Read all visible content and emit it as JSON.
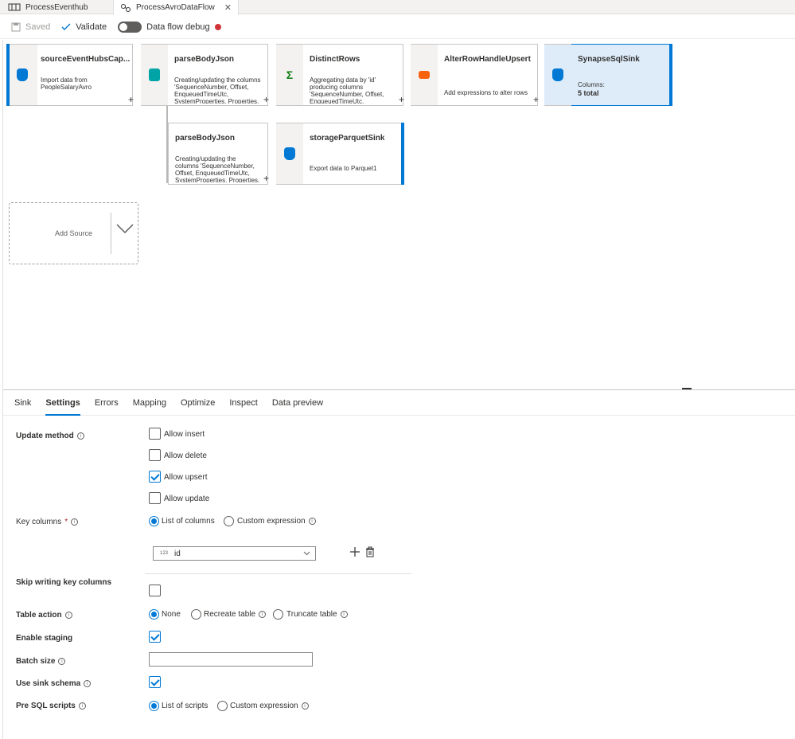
{
  "tabs": [
    {
      "label": "ProcessEventhub",
      "active": false
    },
    {
      "label": "ProcessAvroDataFlow",
      "active": true,
      "close": "✕"
    }
  ],
  "toolbar": {
    "saved": "Saved",
    "validate": "Validate",
    "debug": "Data flow debug"
  },
  "nodes": {
    "source": {
      "title": "sourceEventHubsCap...",
      "desc": "Import data from PeopleSalaryAvro"
    },
    "parse1": {
      "title": "parseBodyJson",
      "desc": "Creating/updating the columns 'SequenceNumber, Offset, EnqueuedTimeUtc, SystemProperties, Properties,"
    },
    "distinct": {
      "title": "DistinctRows",
      "desc": "Aggregating data by 'id' producing columns 'SequenceNumber, Offset, EnqueuedTimeUtc,"
    },
    "alter": {
      "title": "AlterRowHandleUpsert",
      "desc": "Add expressions to alter rows"
    },
    "sqlsink": {
      "title": "SynapseSqlSink",
      "cols_label": "Columns:",
      "cols_value": "5 total"
    },
    "parse2": {
      "title": "parseBodyJson",
      "desc": "Creating/updating the columns 'SequenceNumber, Offset, EnqueuedTimeUtc, SystemProperties, Properties,"
    },
    "parquet": {
      "title": "storageParquetSink",
      "desc": "Export data to Parquet1"
    }
  },
  "add_source": "Add Source",
  "panel_tabs": [
    "Sink",
    "Settings",
    "Errors",
    "Mapping",
    "Optimize",
    "Inspect",
    "Data preview"
  ],
  "settings": {
    "update_method": "Update method",
    "allow_insert": "Allow insert",
    "allow_delete": "Allow delete",
    "allow_upsert": "Allow upsert",
    "allow_update": "Allow update",
    "key_columns": "Key columns",
    "list_of_columns": "List of columns",
    "custom_expression": "Custom expression",
    "key_column_badge": "123",
    "key_column_value": "id",
    "skip_writing": "Skip writing key columns",
    "table_action": "Table action",
    "none": "None",
    "recreate": "Recreate table",
    "truncate": "Truncate table",
    "enable_staging": "Enable staging",
    "batch_size": "Batch size",
    "use_sink_schema": "Use sink schema",
    "pre_sql": "Pre SQL scripts",
    "list_of_scripts": "List of scripts",
    "custom_expression2": "Custom expression"
  }
}
